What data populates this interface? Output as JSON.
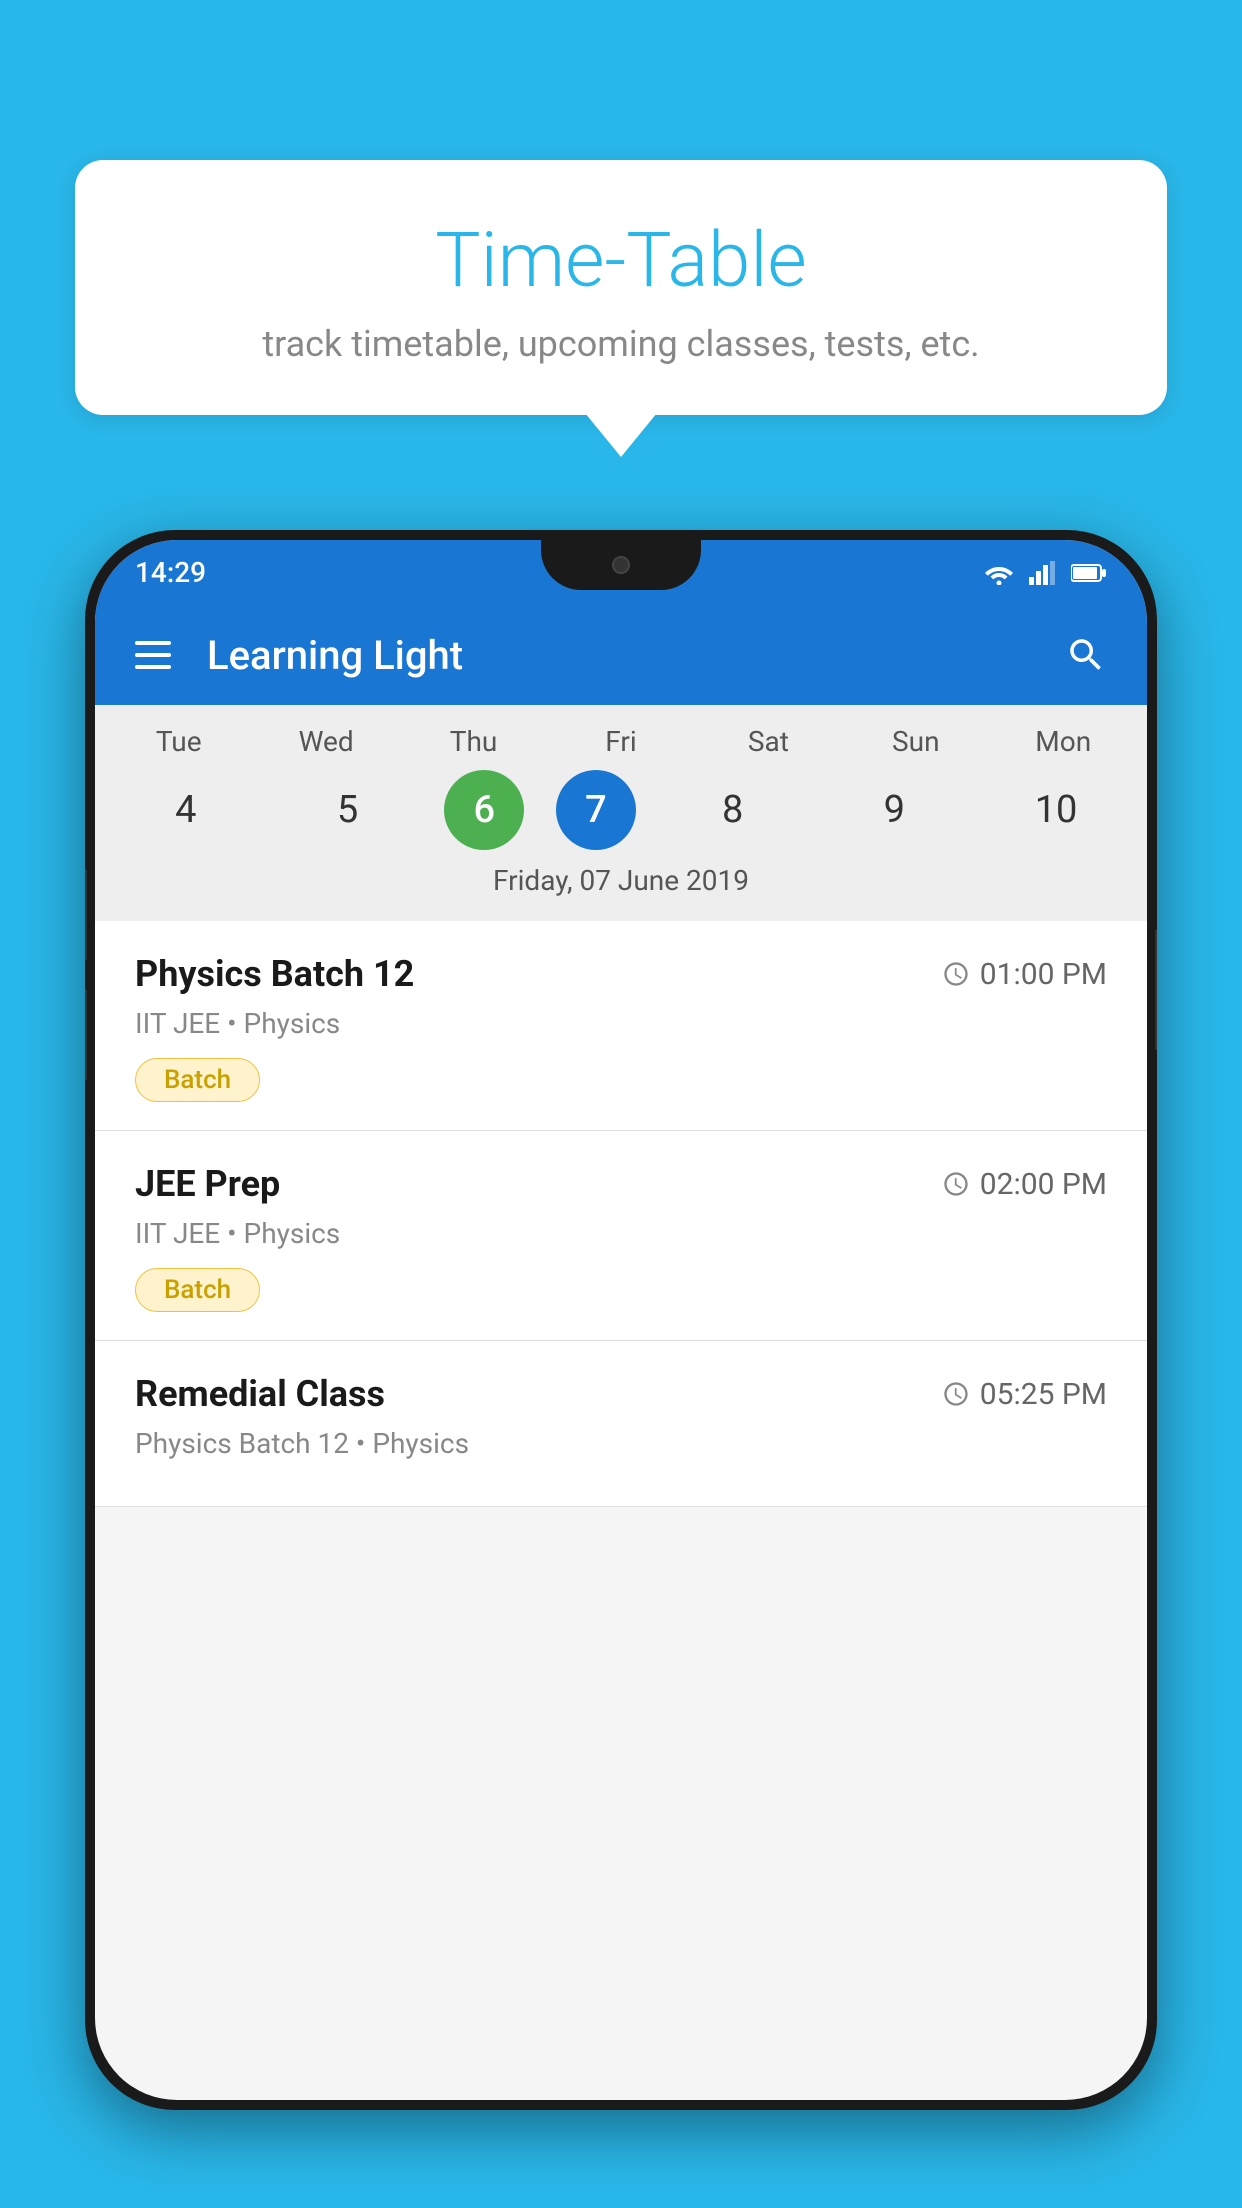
{
  "background_color": "#29b6e8",
  "bubble": {
    "title": "Time-Table",
    "subtitle": "track timetable, upcoming classes, tests, etc."
  },
  "status_bar": {
    "time": "14:29"
  },
  "app_bar": {
    "title": "Learning Light"
  },
  "calendar": {
    "days": [
      {
        "name": "Tue",
        "number": "4"
      },
      {
        "name": "Wed",
        "number": "5"
      },
      {
        "name": "Thu",
        "number": "6",
        "state": "today"
      },
      {
        "name": "Fri",
        "number": "7",
        "state": "selected"
      },
      {
        "name": "Sat",
        "number": "8"
      },
      {
        "name": "Sun",
        "number": "9"
      },
      {
        "name": "Mon",
        "number": "10"
      }
    ],
    "selected_date": "Friday, 07 June 2019"
  },
  "schedule": [
    {
      "title": "Physics Batch 12",
      "time": "01:00 PM",
      "subtitle": "IIT JEE • Physics",
      "tag": "Batch"
    },
    {
      "title": "JEE Prep",
      "time": "02:00 PM",
      "subtitle": "IIT JEE • Physics",
      "tag": "Batch"
    },
    {
      "title": "Remedial Class",
      "time": "05:25 PM",
      "subtitle": "Physics Batch 12 • Physics",
      "tag": ""
    }
  ]
}
